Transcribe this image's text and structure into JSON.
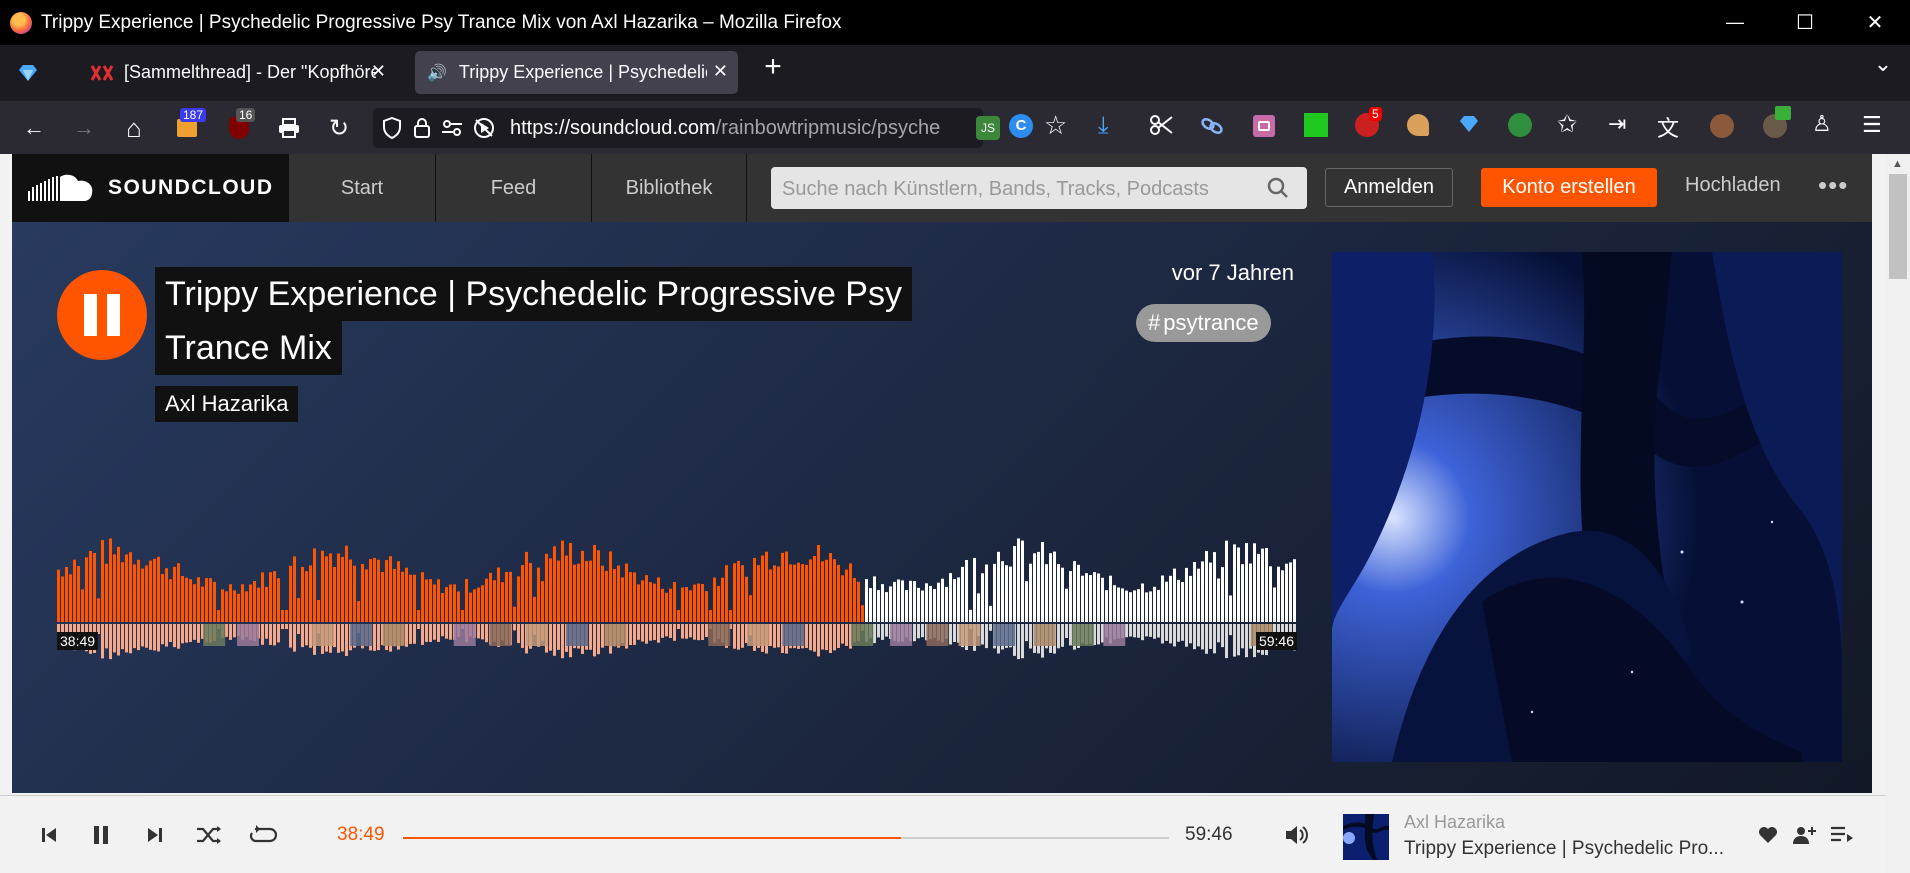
{
  "window": {
    "title": "Trippy Experience | Psychedelic Progressive Psy Trance Mix von Axl Hazarika – Mozilla Firefox",
    "minimize_glyph": "—",
    "maximize_glyph": "☐",
    "close_glyph": "✕"
  },
  "tabs": [
    {
      "label": "[Sammelthread] - Der \"Kopfhöre",
      "close": "✕",
      "active": false
    },
    {
      "label": "Trippy Experience | Psychedelic |",
      "close": "✕",
      "active": true
    }
  ],
  "tabbar": {
    "new_tab": "+",
    "list_tabs": "⌄"
  },
  "navbar": {
    "back": "←",
    "forward": "→",
    "home": "⌂",
    "reload": "↻",
    "url_host": "https://soundcloud.com",
    "url_path": "/rainbowtripmusic/psyche",
    "badge_1": "187",
    "badge_2": "16",
    "badge_3": "5"
  },
  "soundcloud": {
    "brand": "SOUNDCLOUD",
    "nav": [
      "Start",
      "Feed",
      "Bibliothek"
    ],
    "search_placeholder": "Suche nach Künstlern, Bands, Tracks, Podcasts",
    "login": "Anmelden",
    "create_account": "Konto erstellen",
    "upload": "Hochladen",
    "more": "•••"
  },
  "track": {
    "title_line_1": "Trippy Experience | Psychedelic Progressive Psy",
    "title_line_2": "Trance Mix",
    "artist": "Axl Hazarika",
    "posted": "vor 7 Jahren",
    "tag": "psytrance",
    "tag_hash": "#",
    "current_time": "38:49",
    "duration": "59:46",
    "progress": 0.65
  },
  "player": {
    "current_time": "38:49",
    "duration": "59:46",
    "artist": "Axl Hazarika",
    "title": "Trippy Experience | Psychedelic Pro..."
  },
  "colors": {
    "accent": "#ff5500",
    "hero_dark": "#121826",
    "hero_light": "#283a5e",
    "header": "#333333"
  }
}
